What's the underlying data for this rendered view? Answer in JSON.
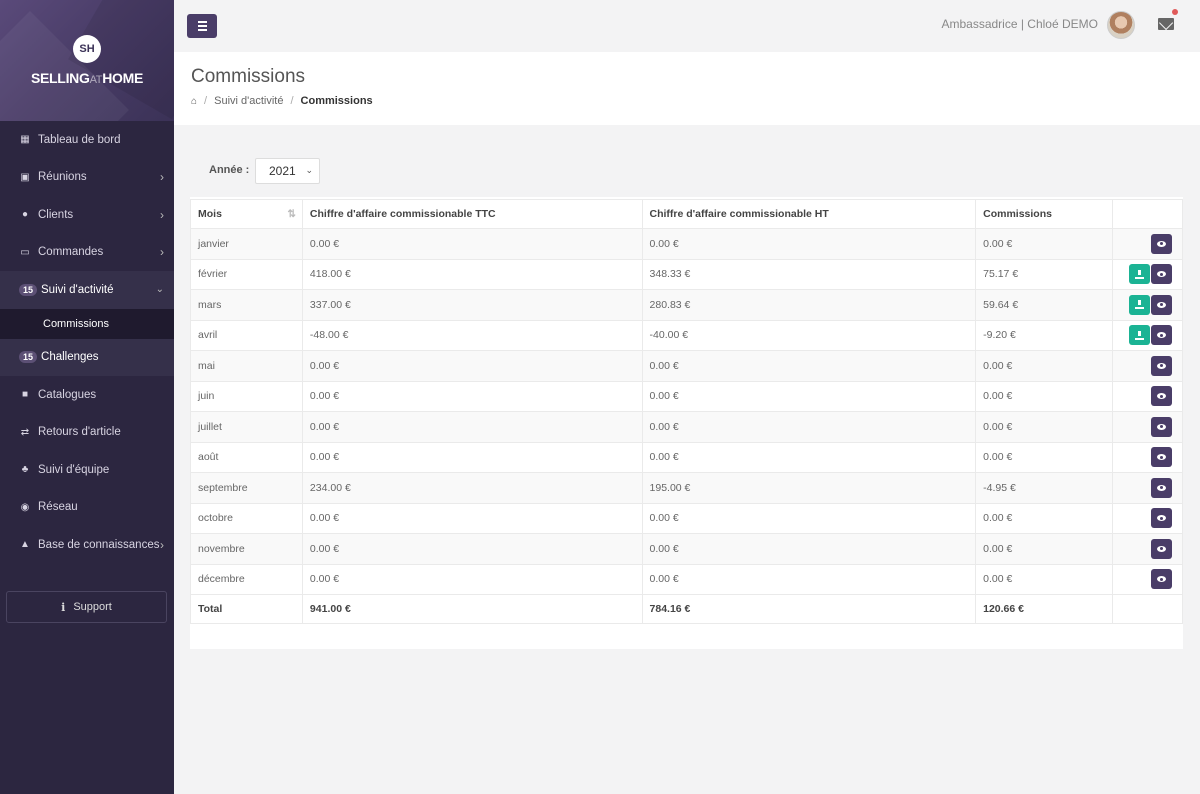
{
  "brand": {
    "logo_initials": "SH",
    "name_part1": "SELLING",
    "name_part2": "AT",
    "name_part3": "HOME"
  },
  "sidebar": {
    "items": [
      {
        "label": "Tableau de bord",
        "icon": "dashboard-icon",
        "has_submenu": false
      },
      {
        "label": "Réunions",
        "icon": "calendar-icon",
        "has_submenu": true
      },
      {
        "label": "Clients",
        "icon": "users-icon",
        "has_submenu": true
      },
      {
        "label": "Commandes",
        "icon": "card-icon",
        "has_submenu": true
      },
      {
        "label": "Suivi d'activité",
        "badge": "15",
        "expanded": true
      },
      {
        "label": "Commissions",
        "selected": true
      },
      {
        "label": "Challenges",
        "badge": "15"
      },
      {
        "label": "Catalogues",
        "icon": "book-icon"
      },
      {
        "label": "Retours d'article",
        "icon": "exchange-icon"
      },
      {
        "label": "Suivi d'équipe",
        "icon": "sitemap-icon"
      },
      {
        "label": "Réseau",
        "icon": "globe-icon"
      },
      {
        "label": "Base de connaissances",
        "icon": "graduation-cap-icon",
        "has_submenu": true
      }
    ],
    "support_label": "Support"
  },
  "topbar": {
    "user_text": "Ambassadrice | Chloé DEMO"
  },
  "page": {
    "title": "Commissions",
    "breadcrumb": [
      "Suivi d'activité",
      "Commissions"
    ]
  },
  "filter": {
    "label": "Année :",
    "year": "2021"
  },
  "table": {
    "headers": [
      "Mois",
      "Chiffre d'affaire commissionable TTC",
      "Chiffre d'affaire commissionable HT",
      "Commissions"
    ],
    "rows": [
      {
        "mois": "janvier",
        "ttc": "0.00 €",
        "ht": "0.00 €",
        "com": "0.00 €",
        "download": false
      },
      {
        "mois": "février",
        "ttc": "418.00 €",
        "ht": "348.33 €",
        "com": "75.17 €",
        "download": true
      },
      {
        "mois": "mars",
        "ttc": "337.00 €",
        "ht": "280.83 €",
        "com": "59.64 €",
        "download": true
      },
      {
        "mois": "avril",
        "ttc": "-48.00 €",
        "ht": "-40.00 €",
        "com": "-9.20 €",
        "download": true
      },
      {
        "mois": "mai",
        "ttc": "0.00 €",
        "ht": "0.00 €",
        "com": "0.00 €",
        "download": false
      },
      {
        "mois": "juin",
        "ttc": "0.00 €",
        "ht": "0.00 €",
        "com": "0.00 €",
        "download": false
      },
      {
        "mois": "juillet",
        "ttc": "0.00 €",
        "ht": "0.00 €",
        "com": "0.00 €",
        "download": false
      },
      {
        "mois": "août",
        "ttc": "0.00 €",
        "ht": "0.00 €",
        "com": "0.00 €",
        "download": false
      },
      {
        "mois": "septembre",
        "ttc": "234.00 €",
        "ht": "195.00 €",
        "com": "-4.95 €",
        "download": false
      },
      {
        "mois": "octobre",
        "ttc": "0.00 €",
        "ht": "0.00 €",
        "com": "0.00 €",
        "download": false
      },
      {
        "mois": "novembre",
        "ttc": "0.00 €",
        "ht": "0.00 €",
        "com": "0.00 €",
        "download": false
      },
      {
        "mois": "décembre",
        "ttc": "0.00 €",
        "ht": "0.00 €",
        "com": "0.00 €",
        "download": false
      }
    ],
    "total": {
      "label": "Total",
      "ttc": "941.00 €",
      "ht": "784.16 €",
      "com": "120.66 €"
    }
  },
  "colors": {
    "sidebar_bg": "#2c2640",
    "brand_purple": "#4a3d68",
    "download_green": "#1bb394",
    "notification_red": "#e05a5a"
  }
}
